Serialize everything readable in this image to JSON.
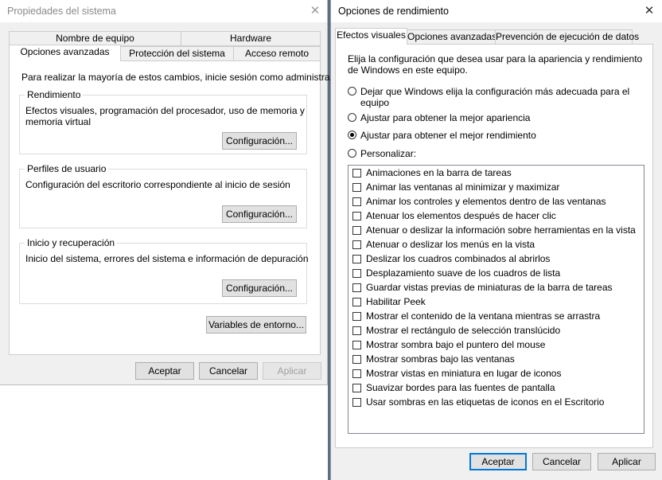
{
  "left_window": {
    "title": "Propiedades del sistema",
    "tabs_row1": [
      "Nombre de equipo",
      "Hardware"
    ],
    "tabs_row2": [
      "Opciones avanzadas",
      "Protección del sistema",
      "Acceso remoto"
    ],
    "admin_note": "Para realizar la mayoría de estos cambios, inicie sesión como administrador.",
    "rendimiento": {
      "legend": "Rendimiento",
      "desc_line1": "Efectos visuales, programación del procesador, uso de memoria y",
      "desc_line2": "memoria virtual",
      "button": "Configuración..."
    },
    "perfiles": {
      "legend": "Perfiles de usuario",
      "desc": "Configuración del escritorio correspondiente al inicio de sesión",
      "button": "Configuración..."
    },
    "inicio": {
      "legend": "Inicio y recuperación",
      "desc": "Inicio del sistema, errores del sistema e información de depuración",
      "button": "Configuración..."
    },
    "env_button": "Variables de entorno...",
    "ok": "Aceptar",
    "cancel": "Cancelar",
    "apply": "Aplicar"
  },
  "right_window": {
    "title": "Opciones de rendimiento",
    "tabs": [
      "Efectos visuales",
      "Opciones avanzadas",
      "Prevención de ejecución de datos"
    ],
    "intro_line1": "Elija la configuración que desea usar para la apariencia y rendimiento",
    "intro_line2": "de Windows en este equipo.",
    "radios": {
      "r1_line1": "Dejar que Windows elija la configuración más adecuada para el",
      "r1_line2": "equipo",
      "r2": "Ajustar para obtener la mejor apariencia",
      "r3": "Ajustar para obtener el mejor rendimiento",
      "r4": "Personalizar:"
    },
    "selected_radio": "r3",
    "checkboxes": [
      "Animaciones en la barra de tareas",
      "Animar las ventanas al minimizar y maximizar",
      "Animar los controles y elementos dentro de las ventanas",
      "Atenuar los elementos después de hacer clic",
      "Atenuar o deslizar la información sobre herramientas en la vista",
      "Atenuar o deslizar los menús en la vista",
      "Deslizar los cuadros combinados al abrirlos",
      "Desplazamiento suave de los cuadros de lista",
      "Guardar vistas previas de miniaturas de la barra de tareas",
      "Habilitar Peek",
      "Mostrar el contenido de la ventana mientras se arrastra",
      "Mostrar el rectángulo de selección translúcido",
      "Mostrar sombra bajo el puntero del mouse",
      "Mostrar sombras bajo las ventanas",
      "Mostrar vistas en miniatura en lugar de iconos",
      "Suavizar bordes para las fuentes de pantalla",
      "Usar sombras en las etiquetas de iconos en el Escritorio"
    ],
    "ok": "Aceptar",
    "cancel": "Cancelar",
    "apply": "Aplicar"
  }
}
